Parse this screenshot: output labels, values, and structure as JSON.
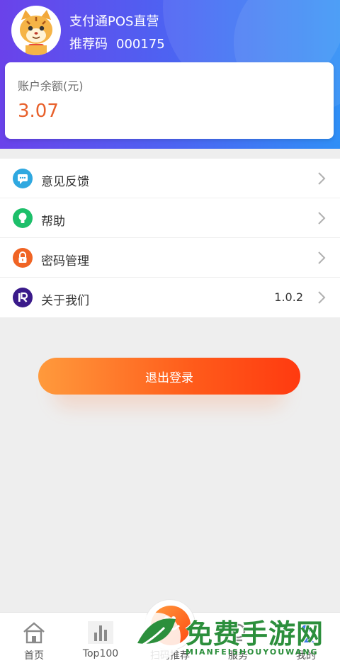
{
  "header": {
    "user_name": "支付通POS直营",
    "referral_label": "推荐码",
    "referral_code": "000175",
    "avatar_icon": "cat-mascot-icon"
  },
  "balance": {
    "label": "账户余额(元)",
    "value": "3.07"
  },
  "menu": [
    {
      "label": "意见反馈",
      "icon": "chat-bubble-icon",
      "color": "#2fa8e0"
    },
    {
      "label": "帮助",
      "icon": "lightbulb-icon",
      "color": "#1dbf6a"
    },
    {
      "label": "密码管理",
      "icon": "lock-icon",
      "color": "#f06424"
    },
    {
      "label": "关于我们",
      "icon": "app-logo-icon",
      "color": "#3a1a8a",
      "value": "1.0.2"
    }
  ],
  "logout_label": "退出登录",
  "tabs": [
    {
      "label": "首页",
      "icon": "home-icon"
    },
    {
      "label": "Top100",
      "icon": "bar-chart-icon"
    },
    {
      "label": "扫码推荐",
      "icon": "scan-icon"
    },
    {
      "label": "服务",
      "icon": "service-icon"
    },
    {
      "label": "我的",
      "icon": "profile-icon"
    }
  ],
  "watermark": {
    "main": "免费手游网",
    "sub": "MIANFEISHOUYOUWANG"
  },
  "colors": {
    "header_start": "#6a42ea",
    "header_end": "#2f8ff6",
    "balance_value": "#e8612c",
    "logout_start": "#ff9a3c",
    "logout_end": "#ff3a10"
  }
}
